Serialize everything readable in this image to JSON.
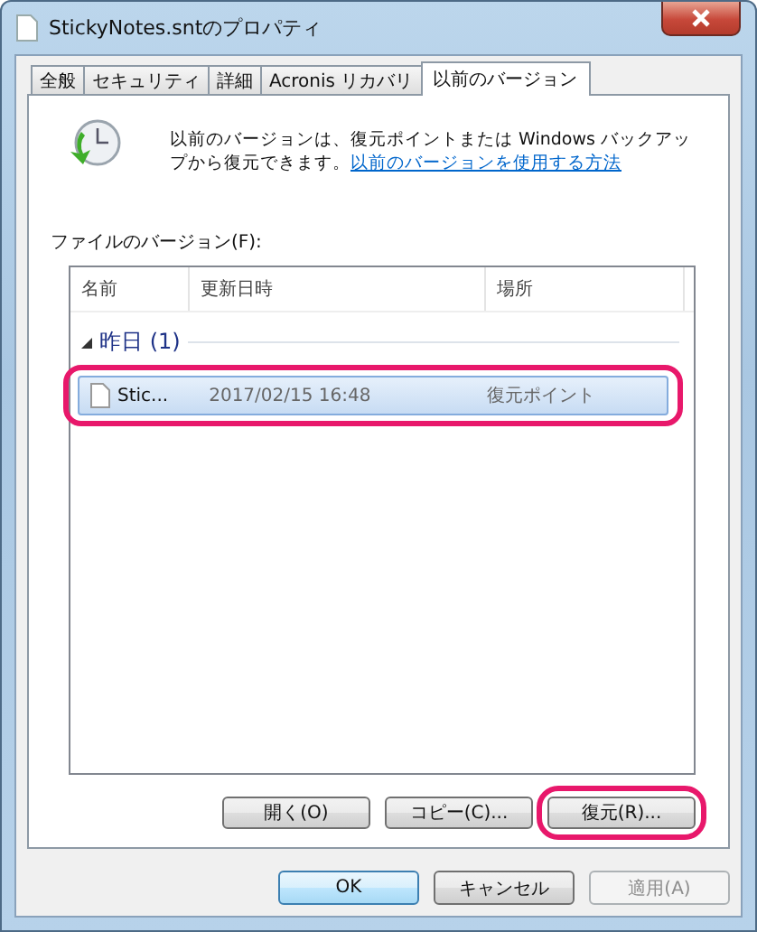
{
  "window": {
    "title": "StickyNotes.sntのプロパティ"
  },
  "tabs": [
    {
      "label": "全般",
      "selected": false
    },
    {
      "label": "セキュリティ",
      "selected": false
    },
    {
      "label": "詳細",
      "selected": false
    },
    {
      "label": "Acronis リカバリ",
      "selected": false
    },
    {
      "label": "以前のバージョン",
      "selected": true
    }
  ],
  "info": {
    "text": "以前のバージョンは、復元ポイントまたは Windows バックアップから復元できます。",
    "link": "以前のバージョンを使用する方法"
  },
  "file_versions": {
    "label": "ファイルのバージョン(F):",
    "columns": [
      "名前",
      "更新日時",
      "場所"
    ],
    "groups": [
      {
        "title": "昨日 (1)",
        "expanded": true,
        "rows": [
          {
            "name": "Stic...",
            "modified": "2017/02/15 16:48",
            "location": "復元ポイント",
            "selected": true,
            "highlighted": true
          }
        ]
      }
    ]
  },
  "actions": [
    {
      "label": "開く(O)",
      "highlighted": false
    },
    {
      "label": "コピー(C)...",
      "highlighted": false
    },
    {
      "label": "復元(R)...",
      "highlighted": true
    }
  ],
  "buttons": [
    {
      "label": "OK",
      "default": true,
      "disabled": false
    },
    {
      "label": "キャンセル",
      "default": false,
      "disabled": false
    },
    {
      "label": "適用(A)",
      "default": false,
      "disabled": true
    }
  ]
}
